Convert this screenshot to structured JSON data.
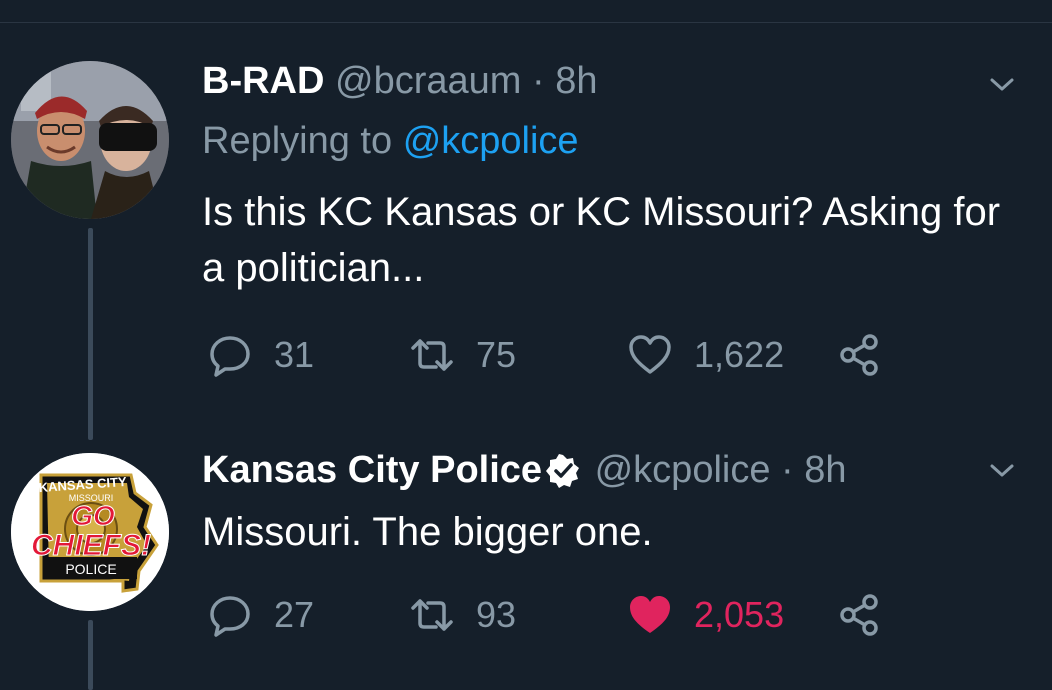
{
  "colors": {
    "background": "#151f2a",
    "muted": "#8899a6",
    "link": "#1da1f2",
    "like_active": "#e0245e",
    "text": "#ffffff"
  },
  "tweets": [
    {
      "display_name": "B-RAD",
      "handle": "@bcraaum",
      "separator": "·",
      "time": "8h",
      "reply_prefix": "Replying to",
      "reply_handle": "@kcpolice",
      "text": "Is this KC Kansas or KC Missouri? Asking for a politician...",
      "replies": "31",
      "retweets": "75",
      "likes": "1,622",
      "liked": false,
      "icons": [
        "reply-icon",
        "retweet-icon",
        "heart-icon",
        "share-icon",
        "chevron-down-icon"
      ]
    },
    {
      "display_name": "Kansas City Police",
      "verified": true,
      "handle": "@kcpolice",
      "separator": "·",
      "time": "8h",
      "text": "Missouri. The bigger one.",
      "replies": "27",
      "retweets": "93",
      "likes": "2,053",
      "liked": true,
      "avatar_text": {
        "top": "KANSAS CITY",
        "sub": "MISSOURI",
        "go": "GO",
        "chiefs": "CHIEFS!",
        "bottom": "POLICE"
      },
      "icons": [
        "reply-icon",
        "retweet-icon",
        "heart-filled-icon",
        "share-icon",
        "chevron-down-icon",
        "verified-badge-icon"
      ]
    }
  ]
}
